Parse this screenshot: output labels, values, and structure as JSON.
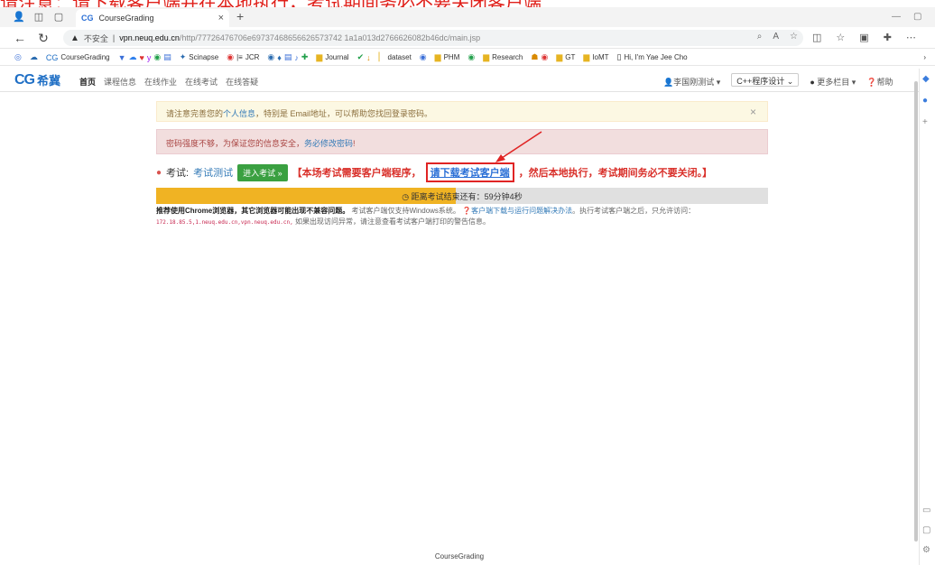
{
  "caption": "请注意：请下载客户端并在本地执行，考试期间务必不要关闭客户端",
  "tab": {
    "favicon": "CG",
    "title": "CourseGrading"
  },
  "addressbar": {
    "insecure_label": "不安全",
    "url_host": "vpn.neuq.edu.cn",
    "url_rest": "/http/77726476706e69737468656626573742 1a1a013d2766626082b46dc/main.jsp"
  },
  "bookmarks": [
    {
      "icon": "cg-icon",
      "label": "CourseGrading"
    },
    {
      "icon": "scinapse-icon",
      "label": "Scinapse"
    },
    {
      "icon": "jcr-icon",
      "label": "JCR"
    },
    {
      "icon": "folder-icon",
      "label": "Journal"
    },
    {
      "icon": "folder-icon",
      "label": "dataset"
    },
    {
      "icon": "folder-icon",
      "label": "PHM"
    },
    {
      "icon": "folder-icon",
      "label": "Research"
    },
    {
      "icon": "folder-icon",
      "label": "GT"
    },
    {
      "icon": "folder-icon",
      "label": "IoMT"
    },
    {
      "icon": "page-icon",
      "label": "Hi, I'm Yae Jee Cho"
    }
  ],
  "site": {
    "logo_text": "CG",
    "logo_cn": "希冀",
    "menu": [
      "首页",
      "课程信息",
      "在线作业",
      "在线考试",
      "在线答疑"
    ],
    "user": "李国刚测试 ▾",
    "course": "C++程序设计",
    "more": "更多栏目 ▾",
    "help": "帮助"
  },
  "alerts": {
    "warning_pre": "请注意完善您的",
    "warning_link": "个人信息",
    "warning_post": "，特别是 Email地址，可以帮助您找回登录密码。",
    "danger_pre": "密码强度不够，为保证您的信息安全，",
    "danger_link": "务必修改密码",
    "danger_post": "!"
  },
  "exam": {
    "label": "考试:",
    "name": "考试测试",
    "enter_button": "进入考试 »",
    "notice_pre": "【本场考试需要客户端程序，",
    "download_link": "请下载考试客户端",
    "notice_post": "，然后本地执行，考试期间务必不要关闭。】"
  },
  "progress": {
    "fill_fraction": 0.49,
    "text": "距离考试结束还有：59分钟4秒"
  },
  "notes": {
    "bold": "推荐使用Chrome浏览器，其它浏览器可能出现不兼容问题。",
    "t1": "考试客户端仅支持Windows系统。",
    "link": "客户端下载与运行问题解决办法",
    "t2": "。执行考试客户端之后，只允许访问：",
    "hosts": "172.18.85.5,1.neuq.edu.cn,vpn.neuq.edu.cn,",
    "t3": "如果出现访问异常，请注意查看考试客户端打印的警告信息。"
  },
  "footer": "CourseGrading",
  "colors": {
    "brand": "#1f6fc5",
    "annotation": "#e02424",
    "progress": "#f0b323"
  }
}
